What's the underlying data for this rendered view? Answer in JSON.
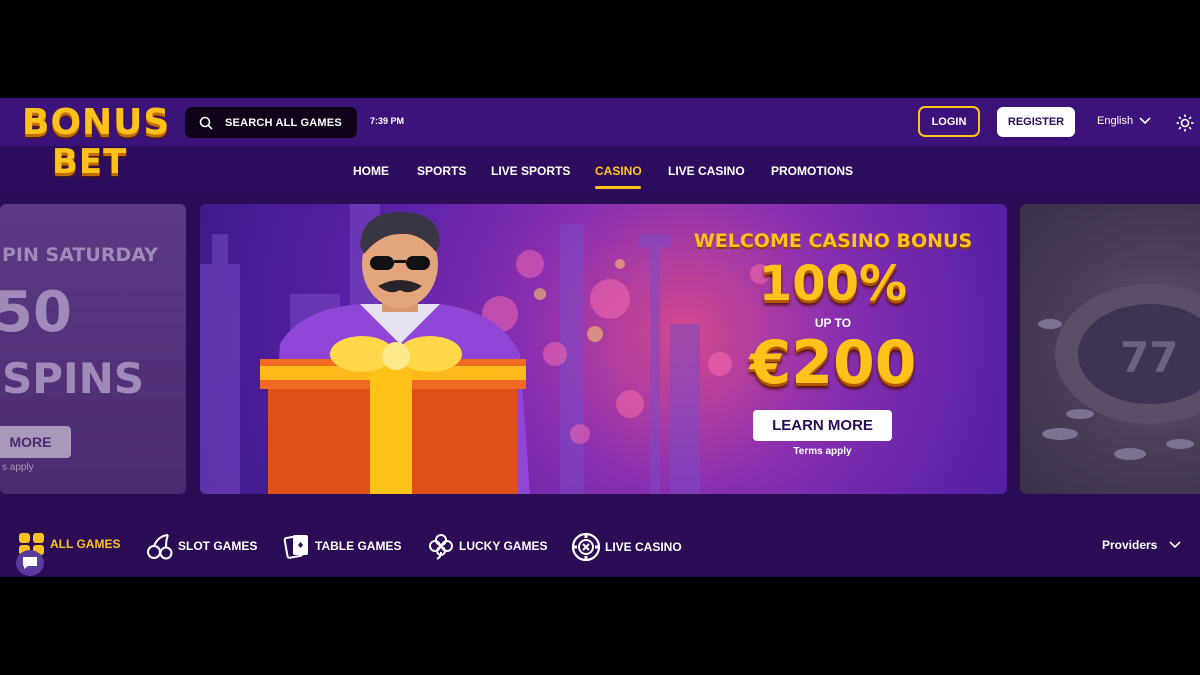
{
  "brand": {
    "logo_line1": "BONUS",
    "logo_line2": "BET",
    "accent": "#ffc21a",
    "bg": "#2a0d55"
  },
  "header": {
    "search_label": "SEARCH ALL GAMES",
    "time": "7:39 PM",
    "login_label": "LOGIN",
    "register_label": "REGISTER",
    "language": "English"
  },
  "nav": {
    "items": [
      {
        "label": "HOME"
      },
      {
        "label": "SPORTS"
      },
      {
        "label": "LIVE SPORTS"
      },
      {
        "label": "CASINO",
        "active": true
      },
      {
        "label": "LIVE CASINO"
      },
      {
        "label": "PROMOTIONS"
      }
    ]
  },
  "banners": {
    "left": {
      "line1": "PIN SATURDAY",
      "line2": "50",
      "line3": "SPINS",
      "button": "MORE",
      "terms": "s apply"
    },
    "main": {
      "title": "WELCOME CASINO BONUS",
      "percent": "100%",
      "up_to": "UP TO",
      "amount": "€200",
      "button": "LEARN MORE",
      "terms": "Terms apply"
    }
  },
  "categories": {
    "items": [
      {
        "label": "ALL GAMES",
        "icon": "grid-icon",
        "active": true
      },
      {
        "label": "SLOT GAMES",
        "icon": "cherries-icon"
      },
      {
        "label": "TABLE GAMES",
        "icon": "cards-icon"
      },
      {
        "label": "LUCKY GAMES",
        "icon": "clover-icon"
      },
      {
        "label": "LIVE CASINO",
        "icon": "chip-icon"
      }
    ],
    "providers_label": "Providers"
  }
}
